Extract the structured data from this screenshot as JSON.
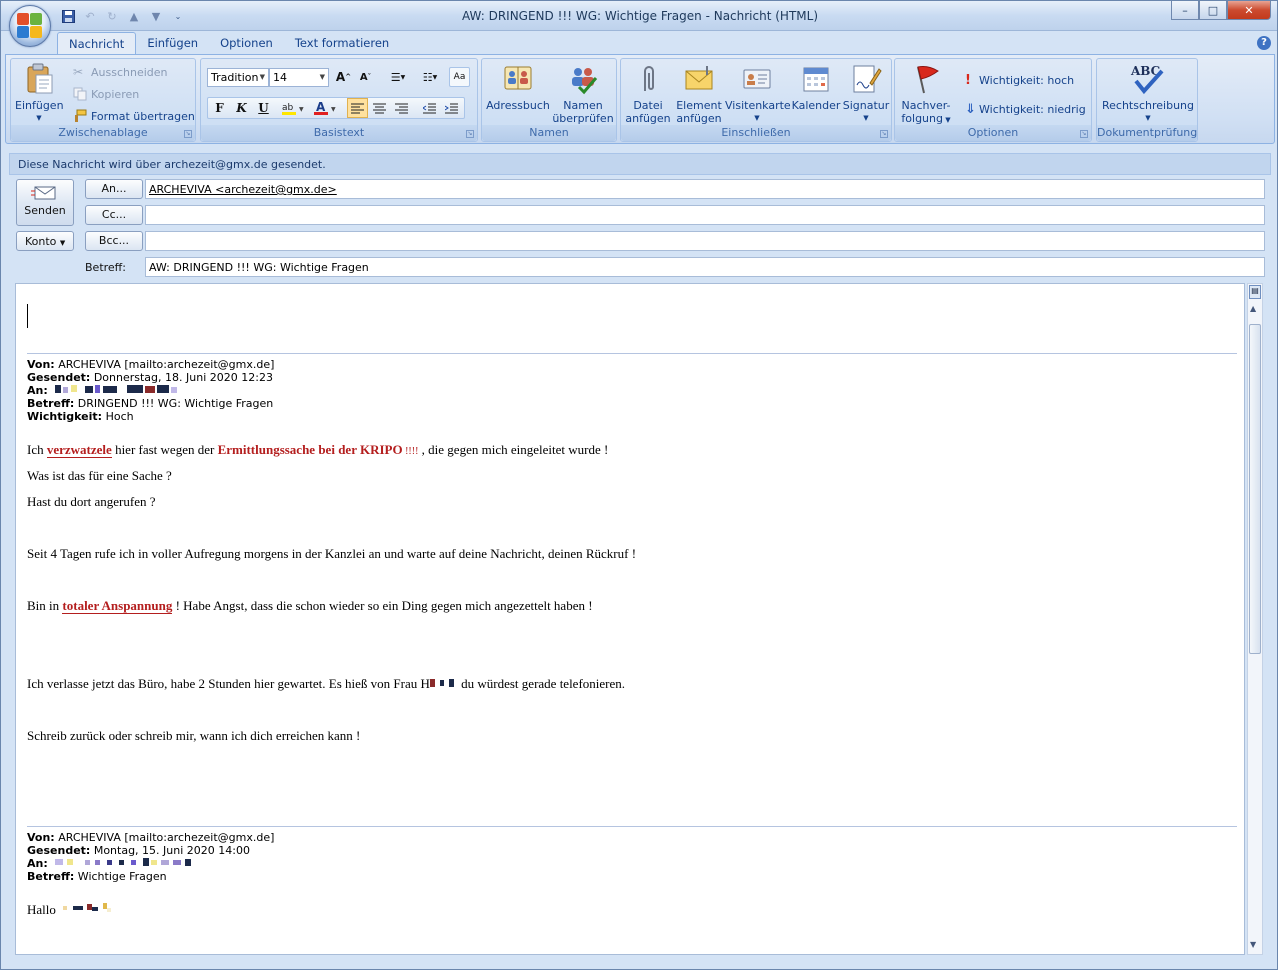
{
  "window": {
    "title": "AW: DRINGEND !!!     WG: Wichtige Fragen  -  Nachricht (HTML)",
    "controls": {
      "minimize": "–",
      "maximize": "□",
      "close": "✕"
    }
  },
  "ribbon_tabs": [
    "Nachricht",
    "Einfügen",
    "Optionen",
    "Text formatieren"
  ],
  "ribbon": {
    "zwischenablage": {
      "label": "Zwischenablage",
      "einfuegen": "Einfügen",
      "ausschneiden": "Ausschneiden",
      "kopieren": "Kopieren",
      "format": "Format übertragen"
    },
    "basistext": {
      "label": "Basistext",
      "font": "Tradition",
      "size": "14",
      "bold": "F",
      "italic": "K",
      "underline": "U"
    },
    "namen": {
      "label": "Namen",
      "adressbuch": "Adressbuch",
      "pruefen_1": "Namen",
      "pruefen_2": "überprüfen"
    },
    "einschliessen": {
      "label": "Einschließen",
      "datei_1": "Datei",
      "datei_2": "anfügen",
      "element_1": "Element",
      "element_2": "anfügen",
      "visitenkarte": "Visitenkarte",
      "kalender": "Kalender",
      "signatur": "Signatur"
    },
    "optionen": {
      "label": "Optionen",
      "nachverfolgung_1": "Nachver-",
      "nachverfolgung_2": "folgung",
      "hoch": "Wichtigkeit: hoch",
      "niedrig": "Wichtigkeit: niedrig"
    },
    "dokumentpruefung": {
      "label": "Dokumentprüfung",
      "rechtschreibung": "Rechtschreibung",
      "abc": "ABC"
    }
  },
  "infobar": "Diese Nachricht wird über archezeit@gmx.de gesendet.",
  "header": {
    "senden": "Senden",
    "konto": "Konto",
    "an_btn": "An...",
    "cc_btn": "Cc...",
    "bcc_btn": "Bcc...",
    "an_value": "ARCHEVIVA <archezeit@gmx.de>",
    "betreff_label": "Betreff:",
    "betreff_value": "AW: DRINGEND !!!     WG: Wichtige Fragen"
  },
  "message": {
    "quote1": {
      "von_label": "Von:",
      "von": " ARCHEVIVA [mailto:archezeit@gmx.de]",
      "gesendet_label": "Gesendet:",
      "gesendet": " Donnerstag, 18. Juni 2020 12:23",
      "an_label": "An:",
      "betreff_label": "Betreff:",
      "betreff": " DRINGEND !!! WG: Wichtige Fragen",
      "wichtigkeit_label": "Wichtigkeit:",
      "wichtigkeit": " Hoch"
    },
    "p1_a": "Ich ",
    "p1_b": "verzwatzele",
    "p1_c": " hier fast wegen der ",
    "p1_d": "Ermittlungssache bei der KRIPO",
    "p1_e": " !!!!",
    "p1_f": " , die gegen mich eingeleitet wurde !",
    "p2": "Was ist das für eine Sache ?",
    "p3": "Hast du dort angerufen ?",
    "p4": "Seit  4 Tagen rufe ich in voller Aufregung morgens in der Kanzlei an und warte auf deine Nachricht, deinen Rückruf !",
    "p5_a": "Bin in ",
    "p5_b": "totaler Anspannung",
    "p5_c": " ! Habe Angst, dass die schon wieder so ein Ding gegen mich angezettelt haben !",
    "p6_a": "Ich verlasse jetzt das Büro, habe 2 Stunden hier gewartet. Es hieß von Frau H",
    "p6_b": " du würdest gerade telefonieren.",
    "p7": "Schreib zurück oder schreib mir, wann ich dich erreichen kann !",
    "quote2": {
      "von_label": "Von:",
      "von": " ARCHEVIVA [mailto:archezeit@gmx.de]",
      "gesendet_label": "Gesendet:",
      "gesendet": " Montag, 15. Juni 2020 14:00",
      "an_label": "An:",
      "betreff_label": "Betreff:",
      "betreff": " Wichtige Fragen"
    },
    "p8": "Hallo "
  }
}
